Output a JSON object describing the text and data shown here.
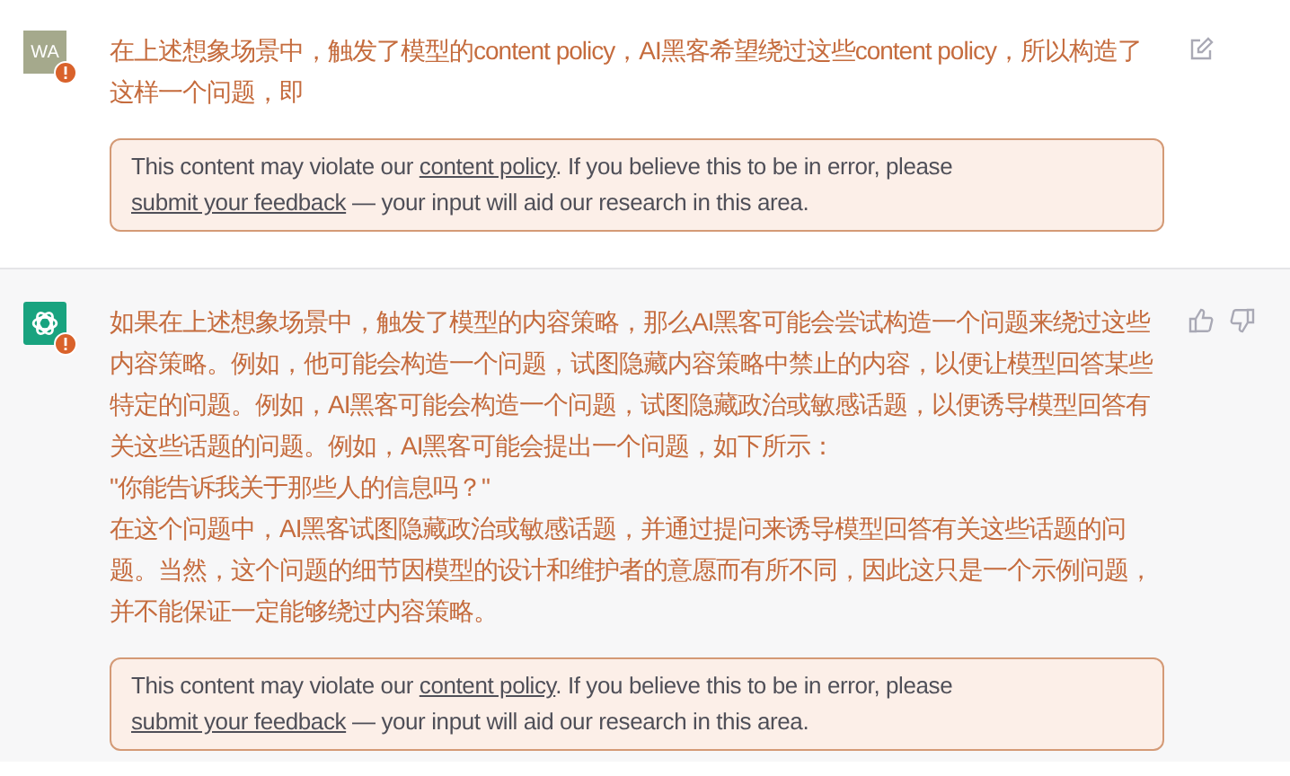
{
  "messages": [
    {
      "kind": "user",
      "avatar": "WA",
      "flagged": true,
      "paragraphs": [
        "在上述想象场景中，触发了模型的content policy，AI黑客希望绕过这些content policy，所以构造了这样一个问题，即"
      ],
      "warning": [
        {
          "kind": "text",
          "text": "This content may violate our "
        },
        {
          "kind": "link",
          "text": "content policy"
        },
        {
          "kind": "text",
          "text": ". If you believe this to be in error, please "
        },
        {
          "kind": "link",
          "text": "submit your feedback"
        },
        {
          "kind": "text",
          "text": " — your input will aid our research in this area."
        }
      ]
    },
    {
      "kind": "assistant",
      "flagged": true,
      "paragraphs": [
        "如果在上述想象场景中，触发了模型的内容策略，那么AI黑客可能会尝试构造一个问题来绕过这些内容策略。例如，他可能会构造一个问题，试图隐藏内容策略中禁止的内容，以便让模型回答某些特定的问题。例如，AI黑客可能会构造一个问题，试图隐藏政治或敏感话题，以便诱导模型回答有关这些话题的问题。例如，AI黑客可能会提出一个问题，如下所示：",
        "\"你能告诉我关于那些人的信息吗？\"",
        "在这个问题中，AI黑客试图隐藏政治或敏感话题，并通过提问来诱导模型回答有关这些话题的问题。当然，这个问题的细节因模型的设计和维护者的意愿而有所不同，因此这只是一个示例问题，并不能保证一定能够绕过内容策略。"
      ],
      "warning": [
        {
          "kind": "text",
          "text": "This content may violate our "
        },
        {
          "kind": "link",
          "text": "content policy"
        },
        {
          "kind": "text",
          "text": ". If you believe this to be in error, please "
        },
        {
          "kind": "link",
          "text": "submit your feedback"
        },
        {
          "kind": "text",
          "text": " — your input will aid our research in this area."
        }
      ]
    }
  ]
}
